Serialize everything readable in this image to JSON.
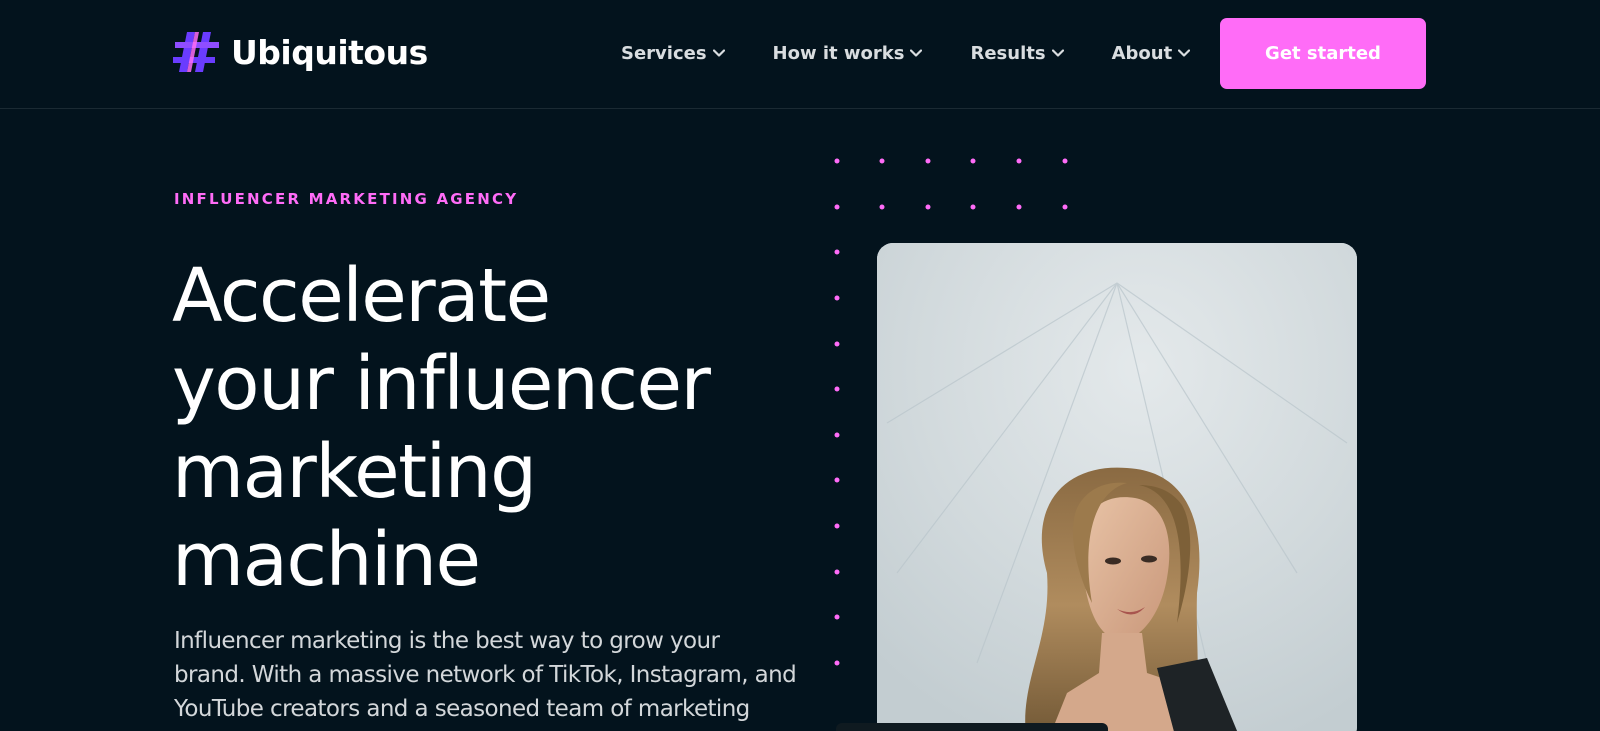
{
  "brand": {
    "name": "Ubiquitous",
    "logo_icon": "hashtag-icon",
    "accent": "#ff6cf7",
    "logo_purple": "#6a3cff"
  },
  "nav": {
    "items": [
      {
        "label": "Services",
        "icon": "chevron-down-icon"
      },
      {
        "label": "How it works",
        "icon": "chevron-down-icon"
      },
      {
        "label": "Results",
        "icon": "chevron-down-icon"
      },
      {
        "label": "About",
        "icon": "chevron-down-icon"
      }
    ],
    "cta_label": "Get started"
  },
  "hero": {
    "eyebrow": "INFLUENCER MARKETING AGENCY",
    "headline_lines": [
      "Accelerate",
      "your influencer",
      "marketing",
      "machine"
    ],
    "lead_lines": [
      "Influencer marketing is the best way to grow your",
      "brand. With a massive network of TikTok, Instagram, and",
      "YouTube creators and a seasoned team of marketing"
    ],
    "image": "influencer-portrait-photo"
  },
  "colors": {
    "background": "#03131d",
    "text": "#ffffff",
    "muted_text": "#d3d7da",
    "cta_bg": "#ff6cf7"
  }
}
